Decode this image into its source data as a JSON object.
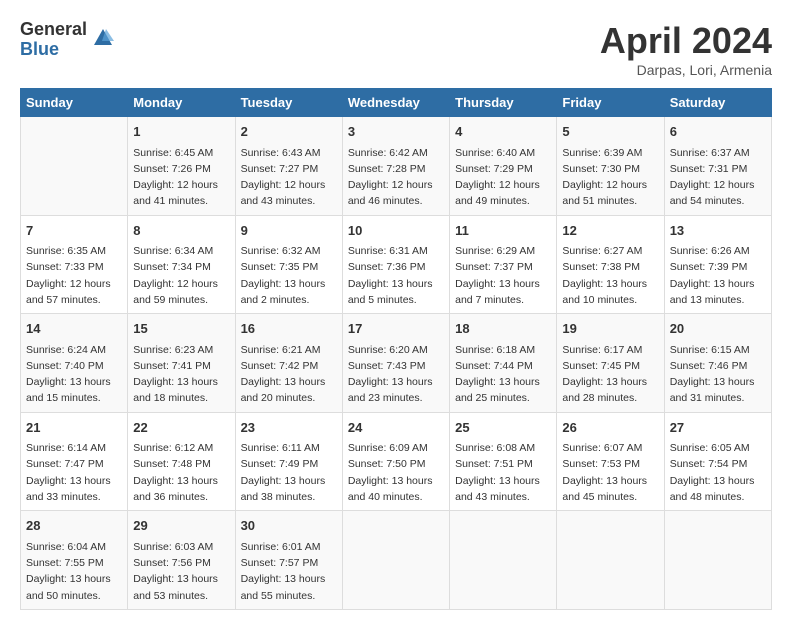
{
  "header": {
    "logo_general": "General",
    "logo_blue": "Blue",
    "title": "April 2024",
    "location": "Darpas, Lori, Armenia"
  },
  "weekdays": [
    "Sunday",
    "Monday",
    "Tuesday",
    "Wednesday",
    "Thursday",
    "Friday",
    "Saturday"
  ],
  "weeks": [
    [
      {
        "day": "",
        "sunrise": "",
        "sunset": "",
        "daylight": ""
      },
      {
        "day": "1",
        "sunrise": "Sunrise: 6:45 AM",
        "sunset": "Sunset: 7:26 PM",
        "daylight": "Daylight: 12 hours and 41 minutes."
      },
      {
        "day": "2",
        "sunrise": "Sunrise: 6:43 AM",
        "sunset": "Sunset: 7:27 PM",
        "daylight": "Daylight: 12 hours and 43 minutes."
      },
      {
        "day": "3",
        "sunrise": "Sunrise: 6:42 AM",
        "sunset": "Sunset: 7:28 PM",
        "daylight": "Daylight: 12 hours and 46 minutes."
      },
      {
        "day": "4",
        "sunrise": "Sunrise: 6:40 AM",
        "sunset": "Sunset: 7:29 PM",
        "daylight": "Daylight: 12 hours and 49 minutes."
      },
      {
        "day": "5",
        "sunrise": "Sunrise: 6:39 AM",
        "sunset": "Sunset: 7:30 PM",
        "daylight": "Daylight: 12 hours and 51 minutes."
      },
      {
        "day": "6",
        "sunrise": "Sunrise: 6:37 AM",
        "sunset": "Sunset: 7:31 PM",
        "daylight": "Daylight: 12 hours and 54 minutes."
      }
    ],
    [
      {
        "day": "7",
        "sunrise": "Sunrise: 6:35 AM",
        "sunset": "Sunset: 7:33 PM",
        "daylight": "Daylight: 12 hours and 57 minutes."
      },
      {
        "day": "8",
        "sunrise": "Sunrise: 6:34 AM",
        "sunset": "Sunset: 7:34 PM",
        "daylight": "Daylight: 12 hours and 59 minutes."
      },
      {
        "day": "9",
        "sunrise": "Sunrise: 6:32 AM",
        "sunset": "Sunset: 7:35 PM",
        "daylight": "Daylight: 13 hours and 2 minutes."
      },
      {
        "day": "10",
        "sunrise": "Sunrise: 6:31 AM",
        "sunset": "Sunset: 7:36 PM",
        "daylight": "Daylight: 13 hours and 5 minutes."
      },
      {
        "day": "11",
        "sunrise": "Sunrise: 6:29 AM",
        "sunset": "Sunset: 7:37 PM",
        "daylight": "Daylight: 13 hours and 7 minutes."
      },
      {
        "day": "12",
        "sunrise": "Sunrise: 6:27 AM",
        "sunset": "Sunset: 7:38 PM",
        "daylight": "Daylight: 13 hours and 10 minutes."
      },
      {
        "day": "13",
        "sunrise": "Sunrise: 6:26 AM",
        "sunset": "Sunset: 7:39 PM",
        "daylight": "Daylight: 13 hours and 13 minutes."
      }
    ],
    [
      {
        "day": "14",
        "sunrise": "Sunrise: 6:24 AM",
        "sunset": "Sunset: 7:40 PM",
        "daylight": "Daylight: 13 hours and 15 minutes."
      },
      {
        "day": "15",
        "sunrise": "Sunrise: 6:23 AM",
        "sunset": "Sunset: 7:41 PM",
        "daylight": "Daylight: 13 hours and 18 minutes."
      },
      {
        "day": "16",
        "sunrise": "Sunrise: 6:21 AM",
        "sunset": "Sunset: 7:42 PM",
        "daylight": "Daylight: 13 hours and 20 minutes."
      },
      {
        "day": "17",
        "sunrise": "Sunrise: 6:20 AM",
        "sunset": "Sunset: 7:43 PM",
        "daylight": "Daylight: 13 hours and 23 minutes."
      },
      {
        "day": "18",
        "sunrise": "Sunrise: 6:18 AM",
        "sunset": "Sunset: 7:44 PM",
        "daylight": "Daylight: 13 hours and 25 minutes."
      },
      {
        "day": "19",
        "sunrise": "Sunrise: 6:17 AM",
        "sunset": "Sunset: 7:45 PM",
        "daylight": "Daylight: 13 hours and 28 minutes."
      },
      {
        "day": "20",
        "sunrise": "Sunrise: 6:15 AM",
        "sunset": "Sunset: 7:46 PM",
        "daylight": "Daylight: 13 hours and 31 minutes."
      }
    ],
    [
      {
        "day": "21",
        "sunrise": "Sunrise: 6:14 AM",
        "sunset": "Sunset: 7:47 PM",
        "daylight": "Daylight: 13 hours and 33 minutes."
      },
      {
        "day": "22",
        "sunrise": "Sunrise: 6:12 AM",
        "sunset": "Sunset: 7:48 PM",
        "daylight": "Daylight: 13 hours and 36 minutes."
      },
      {
        "day": "23",
        "sunrise": "Sunrise: 6:11 AM",
        "sunset": "Sunset: 7:49 PM",
        "daylight": "Daylight: 13 hours and 38 minutes."
      },
      {
        "day": "24",
        "sunrise": "Sunrise: 6:09 AM",
        "sunset": "Sunset: 7:50 PM",
        "daylight": "Daylight: 13 hours and 40 minutes."
      },
      {
        "day": "25",
        "sunrise": "Sunrise: 6:08 AM",
        "sunset": "Sunset: 7:51 PM",
        "daylight": "Daylight: 13 hours and 43 minutes."
      },
      {
        "day": "26",
        "sunrise": "Sunrise: 6:07 AM",
        "sunset": "Sunset: 7:53 PM",
        "daylight": "Daylight: 13 hours and 45 minutes."
      },
      {
        "day": "27",
        "sunrise": "Sunrise: 6:05 AM",
        "sunset": "Sunset: 7:54 PM",
        "daylight": "Daylight: 13 hours and 48 minutes."
      }
    ],
    [
      {
        "day": "28",
        "sunrise": "Sunrise: 6:04 AM",
        "sunset": "Sunset: 7:55 PM",
        "daylight": "Daylight: 13 hours and 50 minutes."
      },
      {
        "day": "29",
        "sunrise": "Sunrise: 6:03 AM",
        "sunset": "Sunset: 7:56 PM",
        "daylight": "Daylight: 13 hours and 53 minutes."
      },
      {
        "day": "30",
        "sunrise": "Sunrise: 6:01 AM",
        "sunset": "Sunset: 7:57 PM",
        "daylight": "Daylight: 13 hours and 55 minutes."
      },
      {
        "day": "",
        "sunrise": "",
        "sunset": "",
        "daylight": ""
      },
      {
        "day": "",
        "sunrise": "",
        "sunset": "",
        "daylight": ""
      },
      {
        "day": "",
        "sunrise": "",
        "sunset": "",
        "daylight": ""
      },
      {
        "day": "",
        "sunrise": "",
        "sunset": "",
        "daylight": ""
      }
    ]
  ]
}
